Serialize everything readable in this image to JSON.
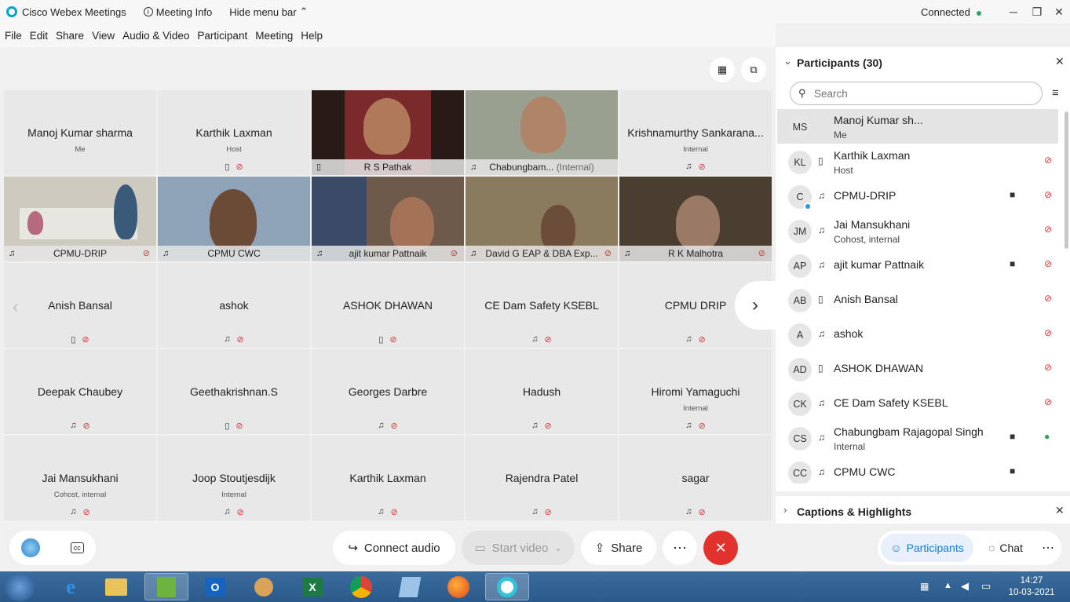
{
  "app": {
    "title": "Cisco Webex Meetings",
    "meeting_info": "Meeting Info",
    "hide_menu": "Hide menu bar",
    "status": "Connected"
  },
  "menu": [
    "File",
    "Edit",
    "Share",
    "View",
    "Audio & Video",
    "Participant",
    "Meeting",
    "Help"
  ],
  "grid": {
    "row1": [
      {
        "name": "Manoj Kumar sharma",
        "sub": "Me"
      },
      {
        "name": "Karthik Laxman",
        "sub": "Host"
      },
      {
        "name": "R S Pathak",
        "video": true
      },
      {
        "name": "Chabungbam...",
        "sub": "(Internal)",
        "video": true
      },
      {
        "name": "Krishnamurthy Sankarana...",
        "sub": "Internal"
      }
    ],
    "row2": [
      {
        "name": "CPMU-DRIP"
      },
      {
        "name": "CPMU CWC"
      },
      {
        "name": "ajit kumar Pattnaik"
      },
      {
        "name": "David G EAP & DBA Exp..."
      },
      {
        "name": "R K Malhotra"
      }
    ],
    "row3": [
      {
        "name": "Anish Bansal"
      },
      {
        "name": "ashok"
      },
      {
        "name": "ASHOK DHAWAN"
      },
      {
        "name": "CE Dam Safety KSEBL"
      },
      {
        "name": "CPMU DRIP"
      }
    ],
    "row4": [
      {
        "name": "Deepak Chaubey"
      },
      {
        "name": "Geethakrishnan.S"
      },
      {
        "name": "Georges Darbre"
      },
      {
        "name": "Hadush"
      },
      {
        "name": "Hiromi Yamaguchi",
        "sub": "Internal"
      }
    ],
    "row5": [
      {
        "name": "Jai Mansukhani",
        "sub": "Cohost, internal"
      },
      {
        "name": "Joop Stoutjesdijk",
        "sub": "Internal"
      },
      {
        "name": "Karthik Laxman"
      },
      {
        "name": "Rajendra Patel"
      },
      {
        "name": "sagar"
      }
    ]
  },
  "panel": {
    "title": "Participants (30)",
    "search_placeholder": "Search",
    "participants": [
      {
        "initials": "MS",
        "name": "Manoj Kumar sh...",
        "role": "Me"
      },
      {
        "initials": "KL",
        "name": "Karthik Laxman",
        "role": "Host"
      },
      {
        "initials": "C",
        "name": "CPMU-DRIP"
      },
      {
        "initials": "JM",
        "name": "Jai Mansukhani",
        "role": "Cohost, internal"
      },
      {
        "initials": "AP",
        "name": "ajit kumar Pattnaik"
      },
      {
        "initials": "AB",
        "name": "Anish Bansal"
      },
      {
        "initials": "A",
        "name": "ashok"
      },
      {
        "initials": "AD",
        "name": "ASHOK DHAWAN"
      },
      {
        "initials": "CK",
        "name": "CE Dam Safety KSEBL"
      },
      {
        "initials": "CS",
        "name": "Chabungbam Rajagopal Singh",
        "role": "Internal"
      },
      {
        "initials": "CC",
        "name": "CPMU CWC"
      }
    ],
    "captions": "Captions & Highlights"
  },
  "controls": {
    "connect_audio": "Connect audio",
    "start_video": "Start video",
    "share": "Share",
    "participants": "Participants",
    "chat": "Chat"
  },
  "taskbar": {
    "time": "14:27",
    "date": "10-03-2021"
  },
  "colors": {
    "end_button": "#e1322d",
    "accent": "#1a7ad6",
    "mute": "#dd3333"
  }
}
